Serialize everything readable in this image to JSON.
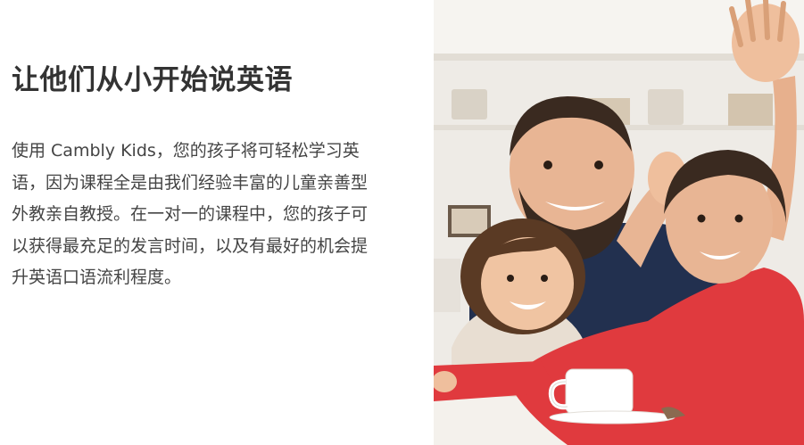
{
  "hero": {
    "title": "让他们从小开始说英语",
    "body": "使用 Cambly Kids，您的孩子将可轻松学习英语，因为课程全是由我们经验丰富的儿童亲善型外教亲自教授。在一对一的课程中，您的孩子可以获得最充足的发言时间，以及有最好的机会提升英语口语流利程度。"
  },
  "image": {
    "subject": "father-and-children-waving-photo"
  },
  "colors": {
    "title": "#333333",
    "body": "#444444",
    "shirt_red": "#e03a3e",
    "shirt_navy": "#22304f"
  }
}
